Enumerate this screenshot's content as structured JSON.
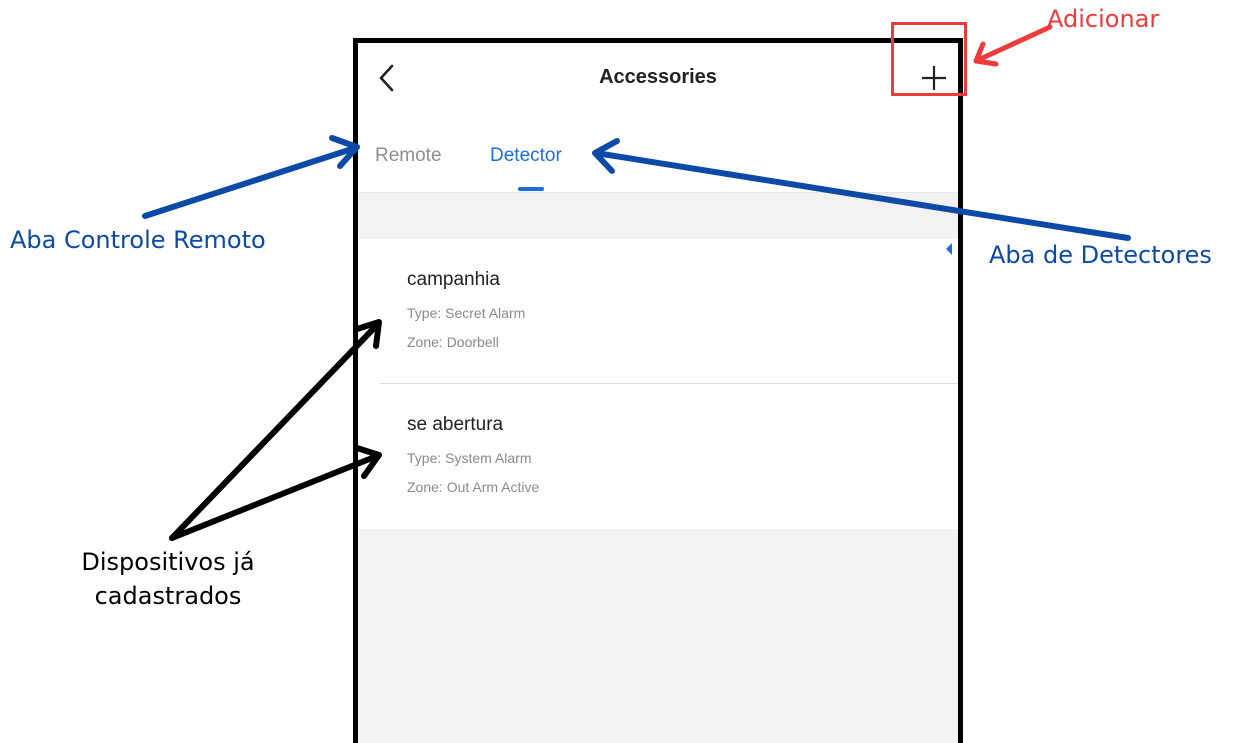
{
  "app": {
    "title": "Accessories",
    "back_icon": "chevron-left-icon",
    "add_icon": "plus-icon"
  },
  "tabs": [
    {
      "label": "Remote",
      "active": false
    },
    {
      "label": "Detector",
      "active": true
    }
  ],
  "devices": [
    {
      "name": "campanhia",
      "type": "Type:  Secret Alarm",
      "zone": "Zone:  Doorbell"
    },
    {
      "name": "se abertura",
      "type": "Type:  System Alarm",
      "zone": "Zone:  Out Arm Active"
    }
  ],
  "annotations": {
    "add": "Adicionar",
    "remote_tab": "Aba Controle Remoto",
    "detector_tab": "Aba de Detectores",
    "registered_devices_line1": "Dispositivos já",
    "registered_devices_line2": "cadastrados"
  },
  "colors": {
    "accent": "#1d6fdc",
    "annotation_red": "#ee3a3a",
    "annotation_blue": "#0d4aa6",
    "inactive_tab": "#8e8e8e"
  }
}
